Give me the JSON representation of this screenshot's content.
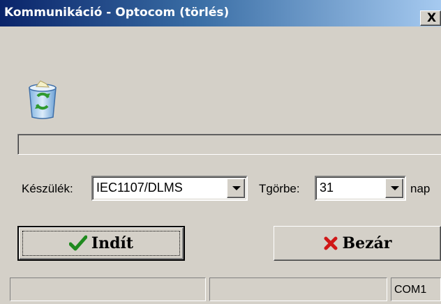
{
  "window": {
    "title": "Kommunikáció - Optocom (törlés)",
    "close_glyph": "X"
  },
  "progress": {
    "value": 0
  },
  "form": {
    "device_label": "Készülék:",
    "device_value": "IEC1107/DLMS",
    "curve_label": "Tgörbe:",
    "curve_value": "31",
    "unit_label": "nap"
  },
  "buttons": {
    "start_label": "Indít",
    "close_label": "Bezár"
  },
  "statusbar": {
    "panels": [
      "",
      "",
      "COM1"
    ]
  },
  "icons": {
    "recycle_bin": "recycle-bin-icon",
    "start": "checkmark-icon",
    "close": "red-x-icon"
  }
}
